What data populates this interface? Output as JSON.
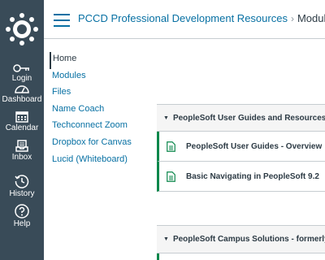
{
  "global_nav": {
    "items": [
      {
        "label": "Login",
        "icon": "login-icon"
      },
      {
        "label": "Dashboard",
        "icon": "dashboard-icon"
      },
      {
        "label": "Calendar",
        "icon": "calendar-icon"
      },
      {
        "label": "Inbox",
        "icon": "inbox-icon"
      },
      {
        "label": "History",
        "icon": "history-icon"
      },
      {
        "label": "Help",
        "icon": "help-icon"
      }
    ]
  },
  "header": {
    "course_link": "PCCD Professional Development Resources",
    "separator": "›",
    "current_page": "Modules"
  },
  "course_nav": {
    "items": [
      {
        "label": "Home",
        "active": true
      },
      {
        "label": "Modules"
      },
      {
        "label": "Files"
      },
      {
        "label": "Name Coach"
      },
      {
        "label": "Techconnect Zoom"
      },
      {
        "label": "Dropbox for Canvas"
      },
      {
        "label": "Lucid (Whiteboard)"
      }
    ]
  },
  "modules": [
    {
      "title": "PeopleSoft User Guides and Resources",
      "items": [
        {
          "title": "PeopleSoft User Guides - Overview",
          "icon": "page-icon"
        },
        {
          "title": "Basic Navigating in PeopleSoft 9.2",
          "icon": "page-icon"
        }
      ]
    },
    {
      "title": "PeopleSoft Campus Solutions - formerly in",
      "items": []
    }
  ],
  "colors": {
    "nav_bg": "#394b58",
    "link": "#0770a3",
    "published": "#0b874b",
    "module_header_bg": "#f5f5f5"
  }
}
